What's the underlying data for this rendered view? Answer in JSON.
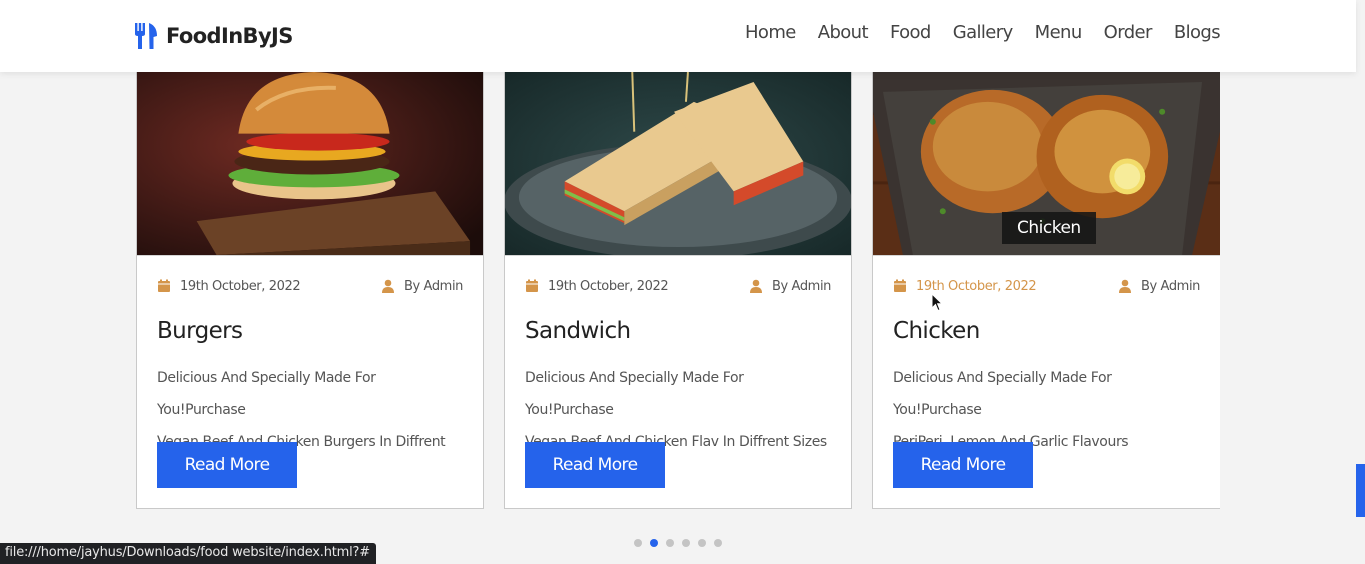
{
  "header": {
    "logo_text": "FoodInByJS",
    "logo_icon": "utensils-icon",
    "nav": [
      {
        "label": "Home"
      },
      {
        "label": "About"
      },
      {
        "label": "Food"
      },
      {
        "label": "Gallery"
      },
      {
        "label": "Menu"
      },
      {
        "label": "Order"
      },
      {
        "label": "Blogs"
      }
    ]
  },
  "cards": [
    {
      "image": "burger-image",
      "date": "19th October, 2022",
      "author": "By Admin",
      "title": "Burgers",
      "desc_line1": "Delicious And Specially Made For You!Purchase",
      "desc_line2": "Vegan Beef And Chicken Burgers In Diffrent Sizes",
      "button": "Read More"
    },
    {
      "image": "sandwich-image",
      "date": "19th October, 2022",
      "author": "By Admin",
      "title": "Sandwich",
      "desc_line1": "Delicious And Specially Made For You!Purchase",
      "desc_line2": "Vegan Beef And Chicken Flav In Diffrent Sizes",
      "button": "Read More"
    },
    {
      "image": "chicken-image",
      "hover_tag": "Chicken",
      "date": "19th October, 2022",
      "author": "By Admin",
      "title": "Chicken",
      "desc_line1": "Delicious And Specially Made For You!Purchase",
      "desc_line2": "PeriPeri ,Lemon And Garlic Flavours",
      "button": "Read More"
    }
  ],
  "pagination": {
    "count": 6,
    "active_index": 1
  },
  "status_bar": {
    "url": "file:///home/jayhus/Downloads/food website/index.html?#"
  },
  "colors": {
    "accent": "#2563eb",
    "meta_icon": "#d4954a",
    "date_hover": "#d4954a"
  }
}
